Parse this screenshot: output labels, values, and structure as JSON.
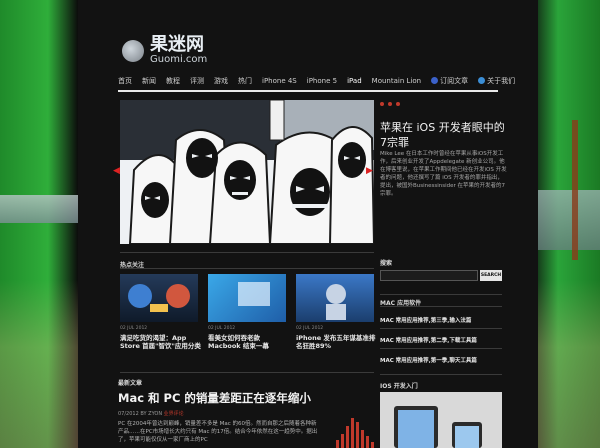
{
  "site": {
    "name_cn": "果迷网",
    "name_en": "Guomi.com"
  },
  "nav": {
    "items": [
      "首页",
      "新闻",
      "教程",
      "评测",
      "游戏",
      "热门",
      "iPhone 4S",
      "iPhone 5",
      "iPad",
      "Mountain Lion"
    ],
    "rss_label": "订阅文章",
    "contact_label": "关于我们"
  },
  "featured": {
    "title": "苹果在 iOS 开发者眼中的7宗罪",
    "excerpt": "Mike Lee 在日本工作时曾经在苹果从事iOS开发工作，后来创业开发了Appdelegate 新创业公司。他在博客里说，在苹果工作期间他已经在开发iOS 开发者的问题，他还撰写了篇 iOS 开发者的罪并指出，提出，被国外Businessinsider 在苹果的开发者的7宗罪。"
  },
  "sections": {
    "hot": "热点关注",
    "latest": "最新文章",
    "search": "搜索",
    "mac_apps": "MAC 应用软件",
    "ios_intro": "IOS 开发入门"
  },
  "search": {
    "button": "SEARCH"
  },
  "hot_items": [
    {
      "date": "02 JUL 2012",
      "title": "满足吃货的渴望：App Store 首届\"智饮\"应用分类"
    },
    {
      "date": "02 JUL 2012",
      "title": "看美女如何吞老款 Macbook 结束一幕"
    },
    {
      "date": "02 JUL 2012",
      "title": "iPhone 发布五年谋基准排名狂胜89%"
    }
  ],
  "mac_links": [
    "MAC 常用应用推荐,第三季,输入法篇",
    "MAC 常用应用推荐,第二季,下载工具篇",
    "MAC 常用应用推荐,第一季,聊天工具篇"
  ],
  "latest_article": {
    "title": "Mac 和 PC 的销量差距正在逐年缩小",
    "date": "07/2012",
    "author": "BY ZYON",
    "category": "业界评论",
    "excerpt": "PC 在2004年曾达到巅峰，销量差不多是 Mac 的60倍。然而自那之后随着各种新产品……在PC市场增长大约只有 Mac 的17倍。结合今年依然在这一趋势中。据出了，苹果可能仅仅从一家厂商上的PC"
  },
  "colors": {
    "accent": "#c0392b",
    "background": "#121212",
    "rule": "#e9e9e9"
  }
}
